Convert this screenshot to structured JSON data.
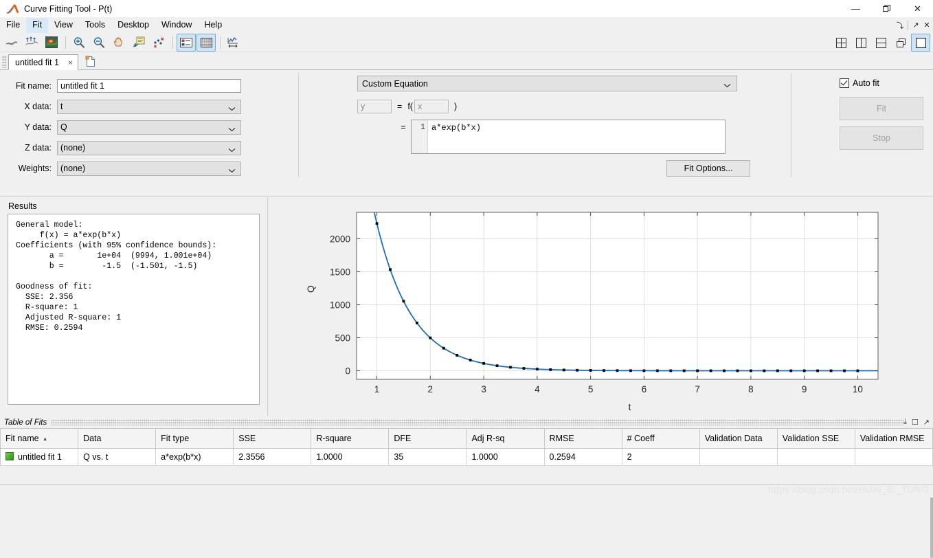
{
  "window": {
    "title": "Curve Fitting Tool - P(t)",
    "icon": "matlab-curve-icon",
    "minimize": "—",
    "restore": "❐",
    "close": "✕"
  },
  "menubar": {
    "items": [
      {
        "label": "File",
        "active": false
      },
      {
        "label": "Fit",
        "active": true
      },
      {
        "label": "View",
        "active": false
      },
      {
        "label": "Tools",
        "active": false
      },
      {
        "label": "Desktop",
        "active": false
      },
      {
        "label": "Window",
        "active": false
      },
      {
        "label": "Help",
        "active": false
      }
    ],
    "right_controls": [
      {
        "name": "dock-arrow",
        "glyph": "⤵"
      },
      {
        "name": "undock-arrow",
        "glyph": "↗"
      },
      {
        "name": "close-panel",
        "glyph": "✕"
      }
    ]
  },
  "toolbar": {
    "buttons": [
      {
        "name": "fit-surface-icon",
        "tip": "Fit",
        "toggled": false
      },
      {
        "name": "exclusion-rules-icon",
        "tip": "Exclude outliers",
        "toggled": false
      },
      {
        "name": "surface-plot-icon",
        "tip": "Surface plot",
        "toggled": false
      },
      {
        "name": "zoom-in-icon",
        "tip": "Zoom In",
        "toggled": false
      },
      {
        "name": "zoom-out-icon",
        "tip": "Zoom Out",
        "toggled": false
      },
      {
        "name": "pan-icon",
        "tip": "Pan",
        "toggled": false
      },
      {
        "name": "data-cursor-icon",
        "tip": "Data Cursor",
        "toggled": false
      },
      {
        "name": "exclude-outliers-icon",
        "tip": "Exclude Outliers",
        "toggled": false
      },
      {
        "name": "legend-icon",
        "tip": "Legend",
        "toggled": true
      },
      {
        "name": "grid-icon",
        "tip": "Grid",
        "toggled": true
      },
      {
        "name": "axes-limits-icon",
        "tip": "Axes Limits",
        "toggled": false
      }
    ],
    "layout_buttons": [
      {
        "name": "layout-four-panel-icon",
        "toggled": false
      },
      {
        "name": "layout-two-column-icon",
        "toggled": false
      },
      {
        "name": "layout-two-row-icon",
        "toggled": false
      },
      {
        "name": "layout-cascade-icon",
        "toggled": false
      },
      {
        "name": "layout-single-icon",
        "toggled": true
      }
    ]
  },
  "tabs": {
    "items": [
      {
        "label": "untitled fit 1",
        "close": "×",
        "active": true
      }
    ],
    "new_tab_name": "new-fit-tab"
  },
  "fit_setup": {
    "fit_name": {
      "label": "Fit name:",
      "value": "untitled fit 1"
    },
    "x_data": {
      "label": "X data:",
      "value": "t"
    },
    "y_data": {
      "label": "Y data:",
      "value": "Q"
    },
    "z_data": {
      "label": "Z data:",
      "value": "(none)"
    },
    "weights": {
      "label": "Weights:",
      "value": "(none)"
    }
  },
  "equation": {
    "fit_type": "Custom Equation",
    "y_placeholder": "y",
    "x_placeholder": "x",
    "eq_sign": "=",
    "f_label": "f(",
    "close_paren": ")",
    "equals2": "=",
    "line_number": "1",
    "code": "a*exp(b*x)",
    "fit_options_label": "Fit Options..."
  },
  "controls": {
    "auto_fit_label": "Auto fit",
    "auto_fit_checked": true,
    "fit_label": "Fit",
    "stop_label": "Stop"
  },
  "results": {
    "title": "Results",
    "text": "General model:\n     f(x) = a*exp(b*x)\nCoefficients (with 95% confidence bounds):\n       a =       1e+04  (9994, 1.001e+04)\n       b =        -1.5  (-1.501, -1.5)\n\nGoodness of fit:\n  SSE: 2.356\n  R-square: 1\n  Adjusted R-square: 1\n  RMSE: 0.2594"
  },
  "chart_data": {
    "type": "scatter",
    "title": "",
    "xlabel": "t",
    "ylabel": "Q",
    "xlim": [
      0.62,
      10.38
    ],
    "ylim": [
      -130,
      2400
    ],
    "xticks": [
      1,
      2,
      3,
      4,
      5,
      6,
      7,
      8,
      9,
      10
    ],
    "yticks": [
      0,
      500,
      1000,
      1500,
      2000
    ],
    "grid": true,
    "legend": "none",
    "series": [
      {
        "name": "Q vs. t",
        "style": "markers",
        "color": "#000000",
        "x": [
          1,
          1.25,
          1.5,
          1.75,
          2,
          2.25,
          2.5,
          2.75,
          3,
          3.25,
          3.5,
          3.75,
          4,
          4.25,
          4.5,
          4.75,
          5,
          5.25,
          5.5,
          5.75,
          6,
          6.25,
          6.5,
          6.75,
          7,
          7.25,
          7.5,
          7.75,
          8,
          8.25,
          8.5,
          8.75,
          9,
          9.25,
          9.5,
          9.75,
          10
        ],
        "y": [
          2231,
          1534,
          1054,
          724,
          498,
          342,
          235,
          162,
          111,
          76.4,
          52.5,
          36.1,
          24.8,
          17.0,
          11.7,
          8.05,
          5.53,
          3.8,
          2.61,
          1.8,
          1.23,
          0.85,
          0.58,
          0.4,
          0.28,
          0.19,
          0.13,
          0.09,
          0.06,
          0.04,
          0.03,
          0.02,
          0.014,
          0.01,
          0.007,
          0.005,
          0.003
        ]
      },
      {
        "name": "untitled fit 1",
        "style": "line",
        "color": "#1f6eb4",
        "equation": "a*exp(b*x)",
        "a": 10000,
        "b": -1.5
      }
    ]
  },
  "table_of_fits": {
    "title": "Table of Fits",
    "panel_controls": [
      {
        "name": "minimize-panel-icon",
        "glyph": "⤓"
      },
      {
        "name": "maximize-panel-icon",
        "glyph": "☐"
      },
      {
        "name": "undock-panel-icon",
        "glyph": "↗"
      }
    ],
    "columns": [
      "Fit name",
      "Data",
      "Fit type",
      "SSE",
      "R-square",
      "DFE",
      "Adj R-sq",
      "RMSE",
      "# Coeff",
      "Validation Data",
      "Validation SSE",
      "Validation RMSE"
    ],
    "sorted_column": "Fit name",
    "sort_direction": "asc",
    "rows": [
      {
        "fit_name": "untitled fit 1",
        "data": "Q vs. t",
        "fit_type": "a*exp(b*x)",
        "sse": "2.3556",
        "r_square": "1.0000",
        "dfe": "35",
        "adj_r_sq": "1.0000",
        "rmse": "0.2594",
        "num_coeff": "2",
        "validation_data": "",
        "validation_sse": "",
        "validation_rmse": ""
      }
    ]
  },
  "watermark": "https://blog.csdn.net/HUAI_BI_TONG",
  "colors": {
    "accent_blue": "#1f6eb4",
    "panel_bg": "#f0f0f0",
    "field_bg": "#e2e2e2",
    "tab_highlight": "#d8eaf9",
    "toggle_blue": "#cde4f7"
  }
}
